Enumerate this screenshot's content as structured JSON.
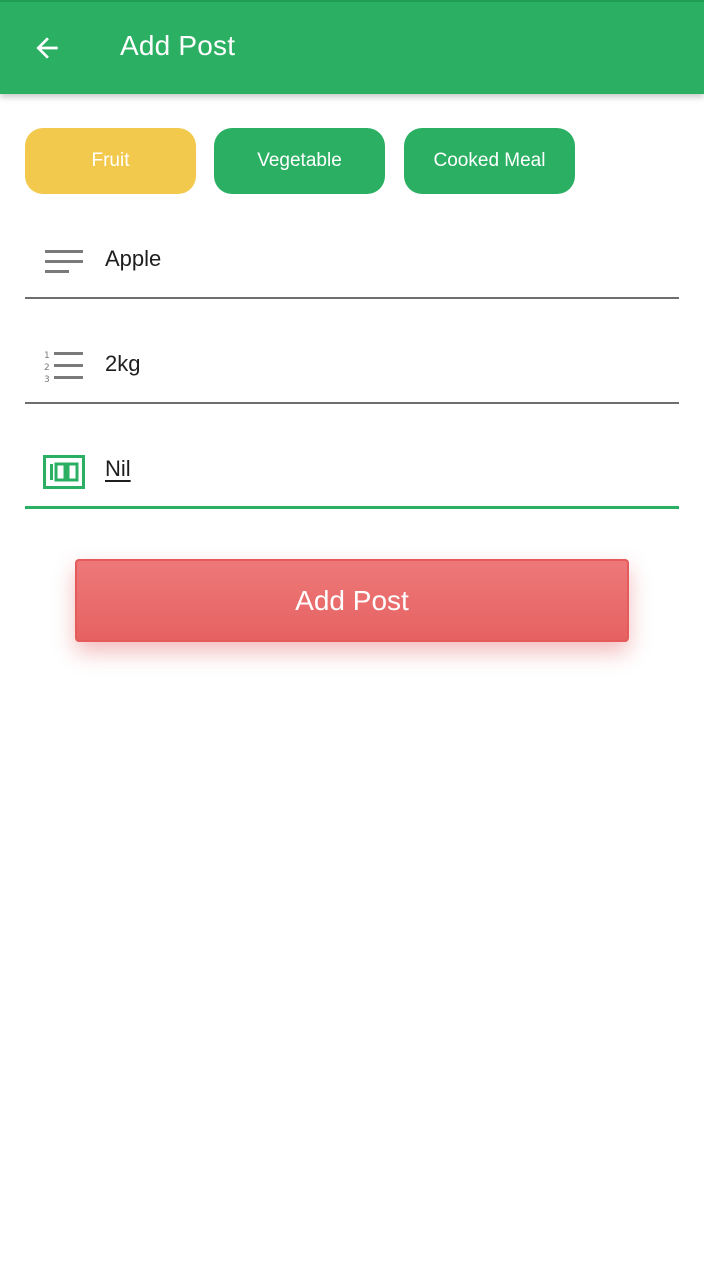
{
  "appbar": {
    "title": "Add Post",
    "back_icon": "arrow-left-icon",
    "color": "#2bb063"
  },
  "categories": [
    {
      "label": "Fruit",
      "selected": true,
      "color": "#f2c94c"
    },
    {
      "label": "Vegetable",
      "selected": false,
      "color": "#2bb063"
    },
    {
      "label": "Cooked Meal",
      "selected": false,
      "color": "#2bb063"
    }
  ],
  "form": {
    "name": {
      "value": "Apple",
      "icon": "subject-lines-icon"
    },
    "quantity": {
      "value": "2kg",
      "icon": "numbered-list-icon"
    },
    "price": {
      "value": "Nil",
      "icon": "money-icon",
      "focused": true
    }
  },
  "submit": {
    "label": "Add Post",
    "color": "#e66262"
  }
}
